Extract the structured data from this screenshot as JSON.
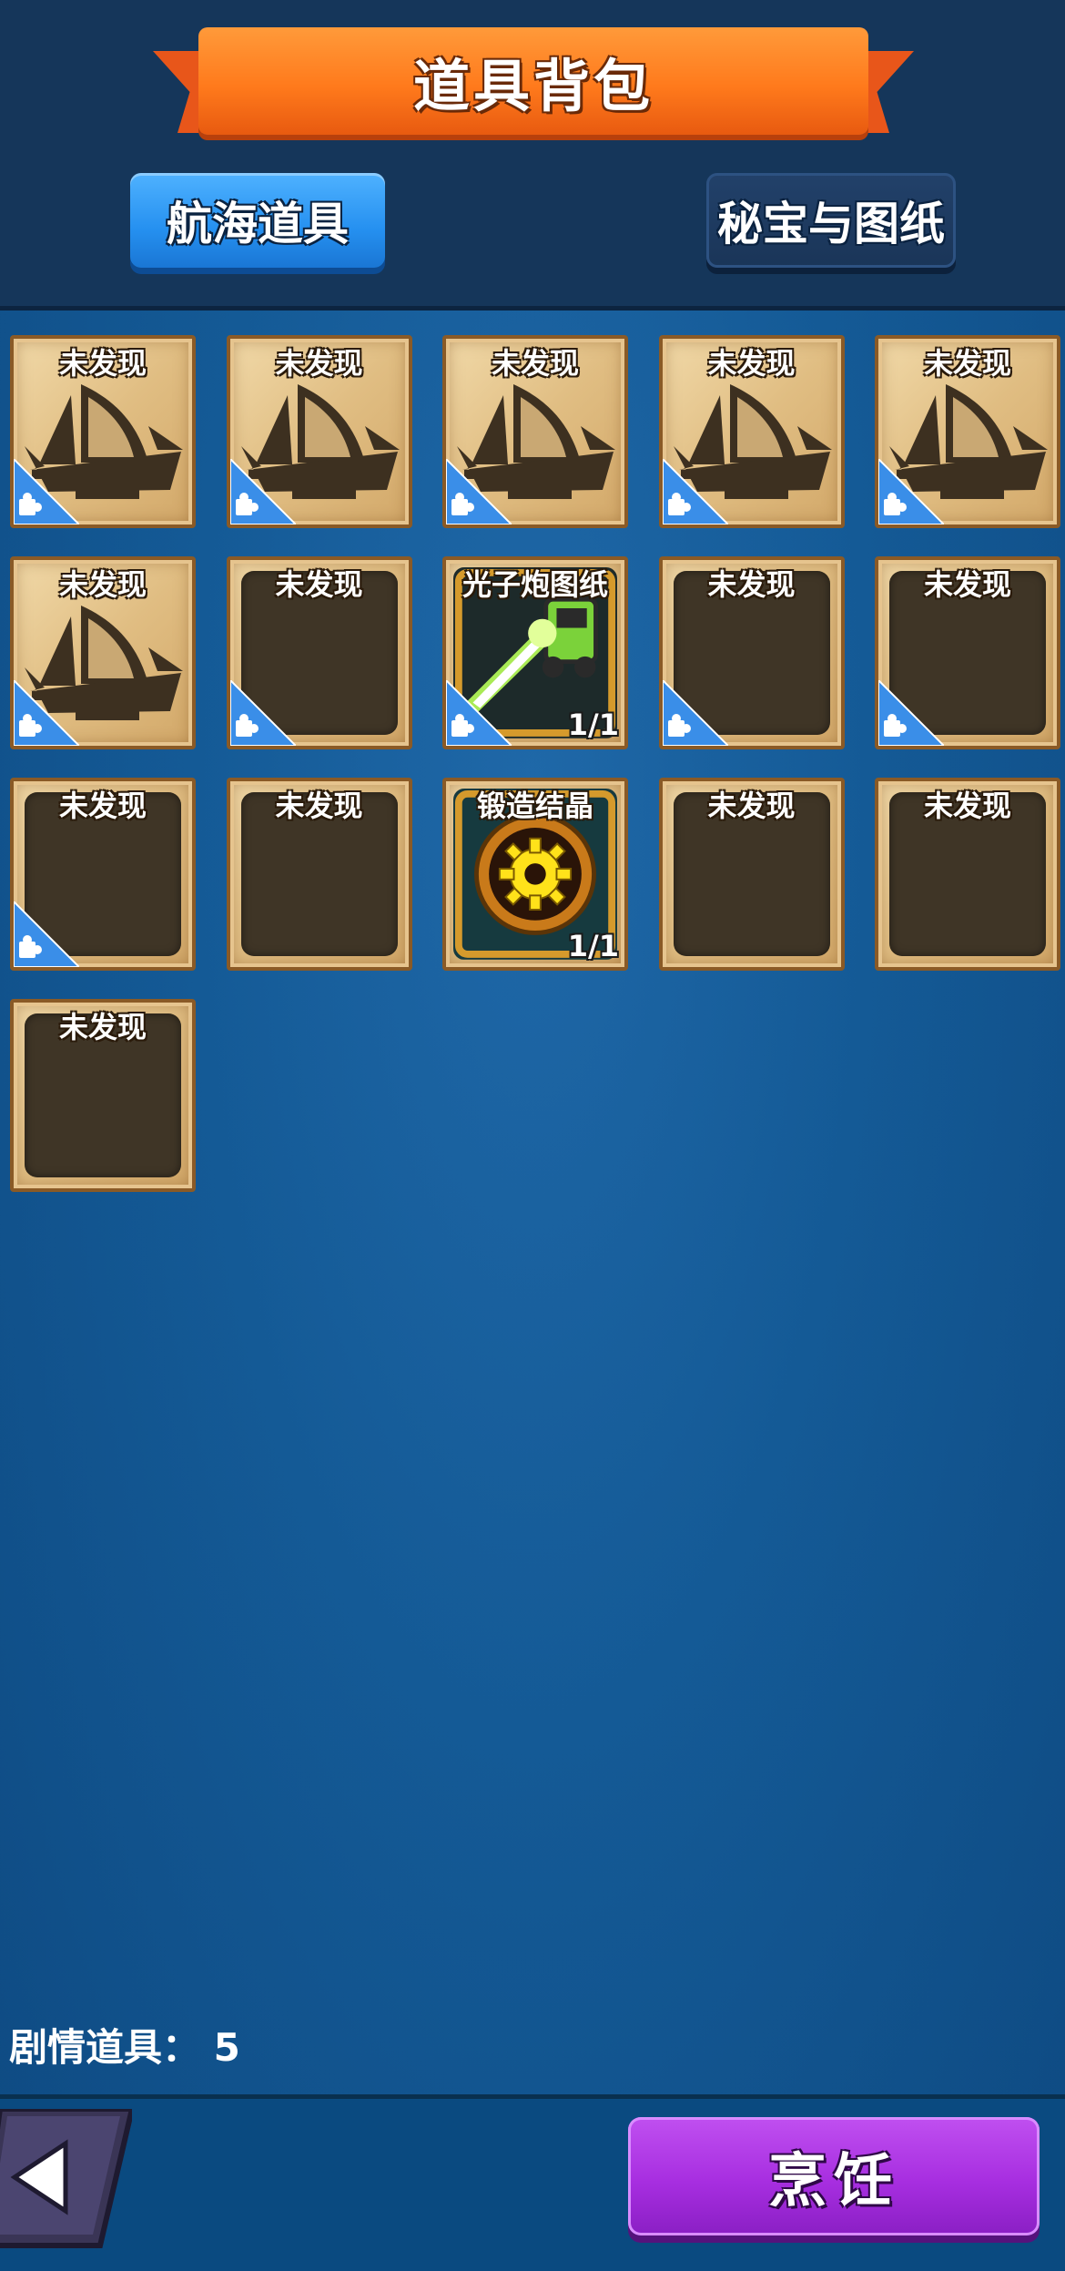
{
  "header": {
    "title": "道具背包"
  },
  "tabs": [
    {
      "label": "航海道具",
      "active": true
    },
    {
      "label": "秘宝与图纸",
      "active": false
    }
  ],
  "slots": [
    {
      "label": "未发现",
      "type": "ship-locked",
      "puzzle": true
    },
    {
      "label": "未发现",
      "type": "ship-locked",
      "puzzle": true
    },
    {
      "label": "未发现",
      "type": "ship-locked",
      "puzzle": true
    },
    {
      "label": "未发现",
      "type": "ship-locked",
      "puzzle": true
    },
    {
      "label": "未发现",
      "type": "ship-locked",
      "puzzle": true
    },
    {
      "label": "未发现",
      "type": "ship-locked",
      "puzzle": true
    },
    {
      "label": "未发现",
      "type": "empty",
      "puzzle": true
    },
    {
      "label": "光子炮图纸",
      "type": "photon-cannon",
      "puzzle": true,
      "count": "1/1"
    },
    {
      "label": "未发现",
      "type": "empty",
      "puzzle": true
    },
    {
      "label": "未发现",
      "type": "empty",
      "puzzle": true
    },
    {
      "label": "未发现",
      "type": "empty",
      "puzzle": true
    },
    {
      "label": "未发现",
      "type": "empty",
      "puzzle": false
    },
    {
      "label": "锻造结晶",
      "type": "forge-crystal",
      "puzzle": false,
      "count": "1/1"
    },
    {
      "label": "未发现",
      "type": "empty",
      "puzzle": false
    },
    {
      "label": "未发现",
      "type": "empty",
      "puzzle": false
    },
    {
      "label": "未发现",
      "type": "empty",
      "puzzle": false
    }
  ],
  "footer": {
    "story_label": "剧情道具：",
    "story_count": "5",
    "cook_button": "烹饪",
    "back_icon": "back-arrow-icon"
  },
  "colors": {
    "active_tab": "#2590f0",
    "cook_button": "#a72ee0",
    "ribbon": "#ff7a1c",
    "puzzle": "#3a8ee8"
  }
}
